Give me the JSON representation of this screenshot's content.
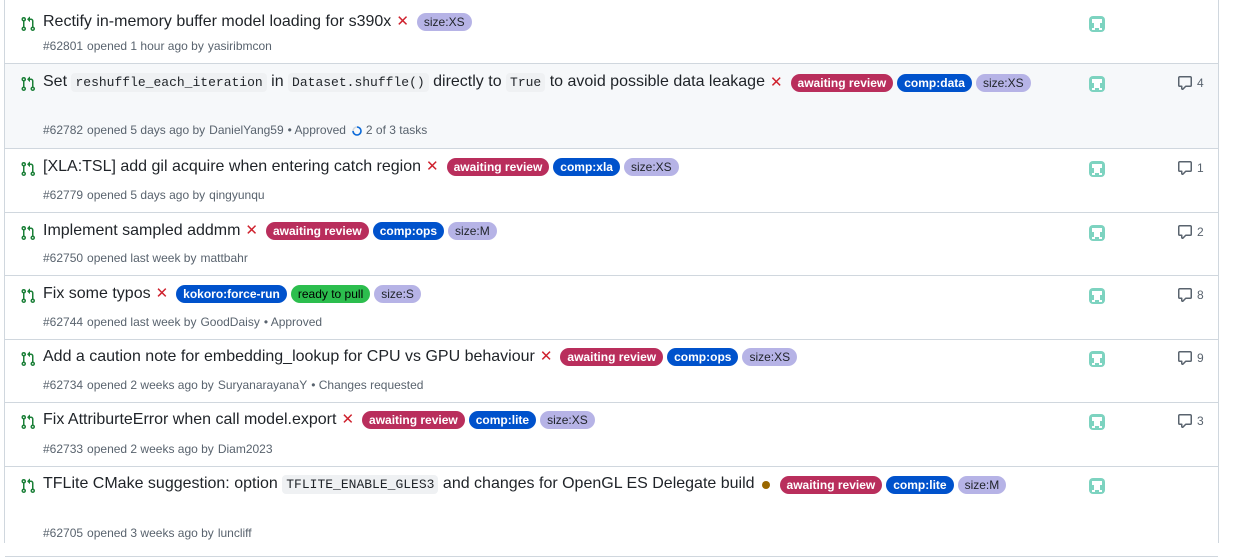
{
  "pull_requests": [
    {
      "title_parts": [
        {
          "t": "Rectify in-memory buffer model loading for s390x",
          "code": false
        }
      ],
      "status": "failing",
      "labels": [
        {
          "text": "size:XS",
          "kind": "size"
        }
      ],
      "number": "#62801",
      "opened": "opened 1 hour ago by",
      "author": "yasiribmcon",
      "review": "",
      "tasks": "",
      "comments": ""
    },
    {
      "title_parts": [
        {
          "t": "Set ",
          "code": false
        },
        {
          "t": "reshuffle_each_iteration",
          "code": true
        },
        {
          "t": " in ",
          "code": false
        },
        {
          "t": "Dataset.shuffle()",
          "code": true
        },
        {
          "t": " directly to ",
          "code": false
        },
        {
          "t": "True",
          "code": true
        },
        {
          "t": " to avoid possible data leakage",
          "code": false
        }
      ],
      "status": "failing",
      "labels": [
        {
          "text": "awaiting review",
          "kind": "await"
        },
        {
          "text": "comp:data",
          "kind": "comp"
        },
        {
          "text": "size:XS",
          "kind": "size"
        }
      ],
      "number": "#62782",
      "opened": "opened 5 days ago by",
      "author": "DanielYang59",
      "review": "• Approved",
      "tasks": "2 of 3 tasks",
      "comments": "4"
    },
    {
      "title_parts": [
        {
          "t": "[XLA:TSL] add gil acquire when entering catch region",
          "code": false
        }
      ],
      "status": "failing",
      "labels": [
        {
          "text": "awaiting review",
          "kind": "await"
        },
        {
          "text": "comp:xla",
          "kind": "comp"
        },
        {
          "text": "size:XS",
          "kind": "size"
        }
      ],
      "number": "#62779",
      "opened": "opened 5 days ago by",
      "author": "qingyunqu",
      "review": "",
      "tasks": "",
      "comments": "1"
    },
    {
      "title_parts": [
        {
          "t": "Implement sampled addmm",
          "code": false
        }
      ],
      "status": "failing",
      "labels": [
        {
          "text": "awaiting review",
          "kind": "await"
        },
        {
          "text": "comp:ops",
          "kind": "comp"
        },
        {
          "text": "size:M",
          "kind": "size"
        }
      ],
      "number": "#62750",
      "opened": "opened last week by",
      "author": "mattbahr",
      "review": "",
      "tasks": "",
      "comments": "2"
    },
    {
      "title_parts": [
        {
          "t": "Fix some typos",
          "code": false
        }
      ],
      "status": "failing",
      "labels": [
        {
          "text": "kokoro:force-run",
          "kind": "comp"
        },
        {
          "text": "ready to pull",
          "kind": "ready"
        },
        {
          "text": "size:S",
          "kind": "size"
        }
      ],
      "number": "#62744",
      "opened": "opened last week by",
      "author": "GoodDaisy",
      "review": "• Approved",
      "tasks": "",
      "comments": "8"
    },
    {
      "title_parts": [
        {
          "t": "Add a caution note for embedding_lookup for CPU vs GPU behaviour",
          "code": false
        }
      ],
      "status": "failing",
      "labels": [
        {
          "text": "awaiting review",
          "kind": "await"
        },
        {
          "text": "comp:ops",
          "kind": "comp"
        },
        {
          "text": "size:XS",
          "kind": "size"
        }
      ],
      "number": "#62734",
      "opened": "opened 2 weeks ago by",
      "author": "SuryanarayanaY",
      "review": "• Changes requested",
      "tasks": "",
      "comments": "9"
    },
    {
      "title_parts": [
        {
          "t": "Fix AttriburteError when call model.export",
          "code": false
        }
      ],
      "status": "failing",
      "labels": [
        {
          "text": "awaiting review",
          "kind": "await"
        },
        {
          "text": "comp:lite",
          "kind": "comp"
        },
        {
          "text": "size:XS",
          "kind": "size"
        }
      ],
      "number": "#62733",
      "opened": "opened 2 weeks ago by",
      "author": "Diam2023",
      "review": "",
      "tasks": "",
      "comments": "3"
    },
    {
      "title_parts": [
        {
          "t": "TFLite CMake suggestion: option ",
          "code": false
        },
        {
          "t": "TFLITE_ENABLE_GLES3",
          "code": true
        },
        {
          "t": " and changes for OpenGL ES Delegate build",
          "code": false
        }
      ],
      "status": "pending",
      "labels": [
        {
          "text": "awaiting review",
          "kind": "await"
        },
        {
          "text": "comp:lite",
          "kind": "comp"
        },
        {
          "text": "size:M",
          "kind": "size"
        }
      ],
      "number": "#62705",
      "opened": "opened 3 weeks ago by",
      "author": "luncliff",
      "review": "",
      "tasks": "",
      "comments": ""
    }
  ],
  "icons": {
    "pr": "git-pull-request-icon",
    "fail": "x-icon",
    "pending": "dot-icon",
    "comment": "comment-icon",
    "avatar": "avatar-icon",
    "progress": "progress-circle-icon"
  },
  "colors": {
    "fail": "#cf222e",
    "pending": "#9a6700",
    "await": "#b92e5c",
    "comp": "#0052cc",
    "size": "#b6b3e6",
    "ready": "#2cbe4e",
    "pr_open": "#1a7f37"
  }
}
